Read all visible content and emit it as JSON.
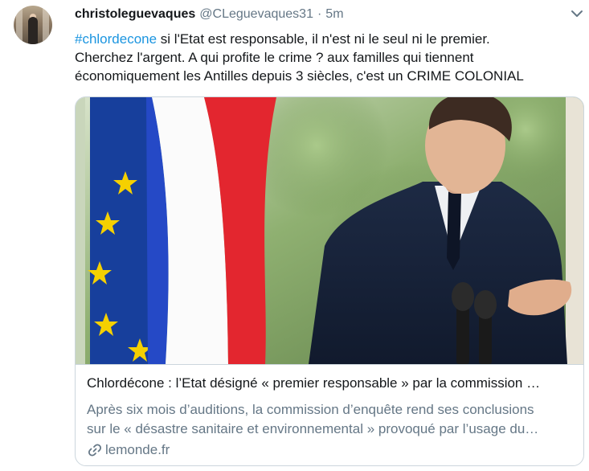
{
  "tweet": {
    "author_name": "christoleguevaques",
    "author_handle": "@CLeguevaques31",
    "separator": "·",
    "time": "5m",
    "hashtag": "#chlordecone",
    "text_line1": " si l'Etat est responsable, il n'est ni le seul ni le premier.",
    "text_line2": "Cherchez l'argent. A qui profite le crime ? aux familles qui tiennent",
    "text_line3": "économiquement les Antilles depuis 3 siècles, c'est un CRIME COLONIAL"
  },
  "card": {
    "title": "Chlordécone : l’Etat désigné « premier responsable » par la commission …",
    "desc_line1": "Après six mois d’auditions, la commission d’enquête rend ses conclusions",
    "desc_line2": "sur le « désastre sanitaire et environnemental » provoqué par l’usage du…",
    "domain": "lemonde.fr"
  },
  "icons": {
    "avatar": "profile-photo",
    "more": "chevron-down-icon",
    "link": "link-icon"
  },
  "colors": {
    "hashtag": "#1b95e0",
    "secondary_text": "#657786",
    "border": "#ccd6dd"
  }
}
